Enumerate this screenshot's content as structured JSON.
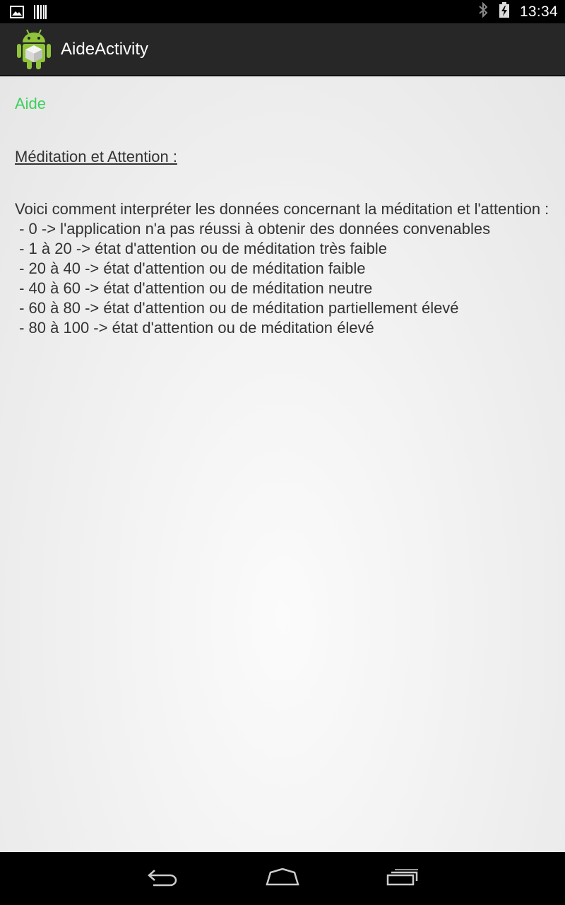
{
  "status_bar": {
    "time": "13:34",
    "left_icons": [
      "image-notification-icon",
      "barcode-notification-icon"
    ],
    "right_icons": [
      "bluetooth-icon",
      "battery-charging-icon"
    ]
  },
  "action_bar": {
    "title": "AideActivity",
    "icon": "android-app-icon"
  },
  "content": {
    "heading": "Aide",
    "section_title": "Méditation et Attention :",
    "intro": "Voici comment interpréter les données concernant la méditation et l'attention :",
    "items": [
      " - 0 -> l'application n'a pas réussi à obtenir des données convenables",
      " - 1 à 20 -> état d'attention ou de méditation très faible",
      " - 20 à 40 -> état d'attention ou de méditation faible",
      " - 40 à 60 -> état d'attention ou de méditation neutre",
      " - 60 à 80 -> état d'attention ou de méditation partiellement élevé",
      " - 80 à 100 -> état d'attention ou de méditation élevé"
    ]
  },
  "nav_bar": {
    "buttons": [
      "back-icon",
      "home-icon",
      "recent-apps-icon"
    ]
  },
  "colors": {
    "accent_heading": "#3fcf5d",
    "action_bar": "#272727",
    "text": "#333333"
  }
}
